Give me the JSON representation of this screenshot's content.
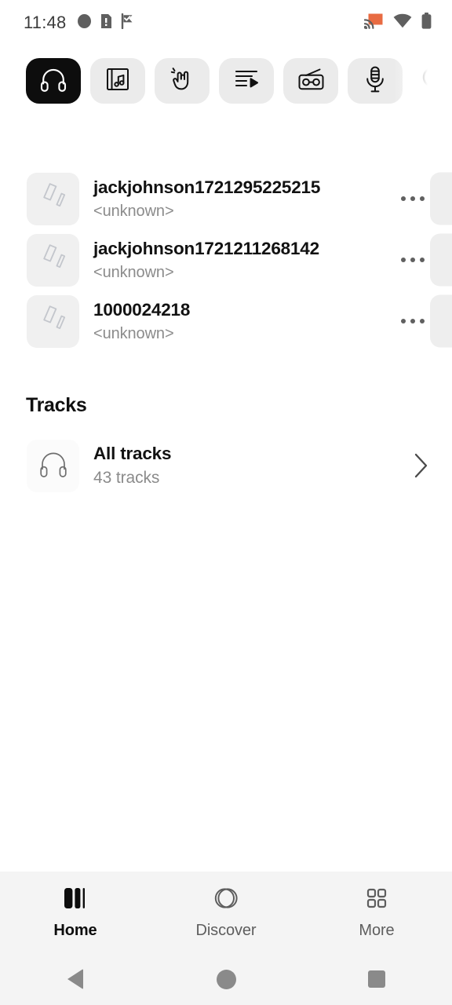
{
  "status_bar": {
    "clock": "11:48",
    "left_icons": [
      "notification-dot-icon",
      "warning-document-icon",
      "flag-check-icon"
    ],
    "right_icons": [
      "cast-icon",
      "wifi-icon",
      "battery-icon"
    ],
    "cast_color": "#e86b42",
    "icon_color": "#5f5f5f"
  },
  "tabs": {
    "items": [
      {
        "name": "songs",
        "icon": "headphones-icon",
        "active": true
      },
      {
        "name": "albums",
        "icon": "album-music-icon",
        "active": false
      },
      {
        "name": "artists",
        "icon": "rock-hand-icon",
        "active": false
      },
      {
        "name": "playlists",
        "icon": "playlist-play-icon",
        "active": false
      },
      {
        "name": "radio",
        "icon": "radio-icon",
        "active": false
      },
      {
        "name": "podcasts",
        "icon": "microphone-icon",
        "active": false
      }
    ],
    "search_icon": "search-icon",
    "active_bg": "#0d0d0d",
    "chip_bg": "#ebebeb"
  },
  "albums": [
    {
      "title": "jackjohnson1721295225215",
      "subtitle": "<unknown>",
      "thumb_icon": "album-placeholder-icon",
      "more_icon": "more-horizontal-icon"
    },
    {
      "title": "jackjohnson1721211268142",
      "subtitle": "<unknown>",
      "thumb_icon": "album-placeholder-icon",
      "more_icon": "more-horizontal-icon"
    },
    {
      "title": "1000024218",
      "subtitle": "<unknown>",
      "thumb_icon": "album-placeholder-icon",
      "more_icon": "more-horizontal-icon"
    }
  ],
  "tracks_section": {
    "heading": "Tracks",
    "item": {
      "title": "All tracks",
      "subtitle": "43 tracks",
      "icon": "headphones-icon",
      "chevron": "chevron-right-icon"
    }
  },
  "bottom_nav": {
    "items": [
      {
        "label": "Home",
        "icon": "equalizer-bars-icon",
        "active": true
      },
      {
        "label": "Discover",
        "icon": "discover-rings-icon",
        "active": false
      },
      {
        "label": "More",
        "icon": "grid-dots-icon",
        "active": false
      }
    ],
    "bg": "#f4f4f4"
  },
  "system_nav": {
    "buttons": [
      {
        "name": "back-button",
        "icon": "triangle-back-icon"
      },
      {
        "name": "home-button",
        "icon": "circle-home-icon"
      },
      {
        "name": "recents-button",
        "icon": "square-recents-icon"
      }
    ]
  }
}
